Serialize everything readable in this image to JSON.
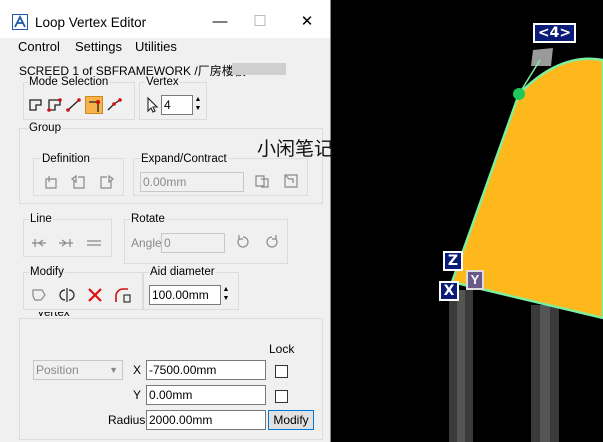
{
  "window": {
    "title": "Loop Vertex Editor",
    "minimize": "—",
    "maximize": "☐",
    "close": "✕"
  },
  "menu": [
    "Control",
    "Settings",
    "Utilities"
  ],
  "info_line": "SCREED 1 of SBFRAMEWORK /厂房楼板",
  "mode_selection": {
    "label": "Mode Selection"
  },
  "vertex": {
    "label": "Vertex",
    "value": "4"
  },
  "group": {
    "label": "Group",
    "definition_label": "Definition",
    "expand_contract_label": "Expand/Contract",
    "expand_value": "0.00mm"
  },
  "line": {
    "label": "Line"
  },
  "rotate": {
    "label": "Rotate",
    "angle_label": "Angle",
    "angle_value": "0"
  },
  "modify": {
    "label": "Modify"
  },
  "aid_diameter": {
    "label": "Aid diameter",
    "value": "100.00mm"
  },
  "vertex_group": {
    "label": "Vertex",
    "lock_label": "Lock",
    "position_select": "Position",
    "x_label": "X",
    "x_value": "-7500.00mm",
    "y_label": "Y",
    "y_value": "0.00mm",
    "radius_label": "Radius",
    "radius_value": "2000.00mm",
    "modify_button": "Modify"
  },
  "overlay_text": "小闲笔记",
  "viewport": {
    "vertex_tag": "<4>",
    "axis_z": "Z",
    "axis_x": "X",
    "axis_y": "Y",
    "slab_color": "#ffb81c",
    "edge_color": "#7df0a0"
  }
}
